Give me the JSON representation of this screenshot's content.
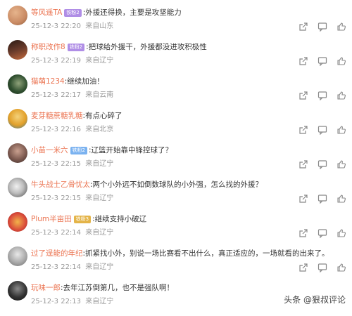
{
  "comments": [
    {
      "name": "等风遥TA",
      "badge": "铁粉2",
      "badge_color": "purple",
      "text": ":外援还得换，主要是攻坚能力",
      "time": "25-12-3 22:20",
      "location": "来自山东",
      "avatar_color": "#c98a63"
    },
    {
      "name": "称职改作8",
      "badge": "铁粉2",
      "badge_color": "purple",
      "text": ":把球给外援干，外援都没进攻积极性",
      "time": "25-12-3 22:19",
      "location": "来自辽宁",
      "avatar_color": "#6a3b2b"
    },
    {
      "name": "猫萌1234",
      "badge": "",
      "badge_color": "",
      "text": ":继续加油！",
      "time": "25-12-3 22:17",
      "location": "来自云南",
      "avatar_color": "#2f4f2f"
    },
    {
      "name": "麦芽糖蔗糖乳糖",
      "badge": "",
      "badge_color": "",
      "text": ":有点心碎了",
      "time": "25-12-3 22:16",
      "location": "来自北京",
      "avatar_color": "#e2a02a"
    },
    {
      "name": "小苗一米六",
      "badge": "铁粉2",
      "badge_color": "blue",
      "text": ":辽篮开始靠中锋控球了？",
      "time": "25-12-3 22:15",
      "location": "来自辽宁",
      "avatar_color": "#7d5a50"
    },
    {
      "name": "牛头战士乙骨忧太",
      "badge": "",
      "badge_color": "",
      "text": ":两个小外远不如倒数球队的小外强，怎么找的外援？",
      "time": "25-12-3 22:15",
      "location": "来自辽宁",
      "avatar_color": "#4a4a4a"
    },
    {
      "name": "Plum半亩田",
      "badge": "铁粉3",
      "badge_color": "gold",
      "text": ":继续支持小破辽",
      "time": "25-12-3 22:14",
      "location": "来自辽宁",
      "avatar_color": "#d94a3a"
    },
    {
      "name": "过了逞能的年纪",
      "badge": "",
      "badge_color": "",
      "text": ":抓紧找小外，别说一场比赛看不出什么，真正适应的，一场就看的出来了。",
      "time": "25-12-3 22:14",
      "location": "来自辽宁",
      "avatar_color": "#a9a9a9"
    },
    {
      "name": "玩味一郎",
      "badge": "",
      "badge_color": "",
      "text": ":去年江苏倒第几，也不是强队啊！",
      "time": "25-12-3 22:13",
      "location": "来自辽宁",
      "avatar_color": "#333333"
    }
  ],
  "icons": [
    "share-icon",
    "comment-icon",
    "like-icon"
  ],
  "watermark": "头条 @狠叔评论"
}
